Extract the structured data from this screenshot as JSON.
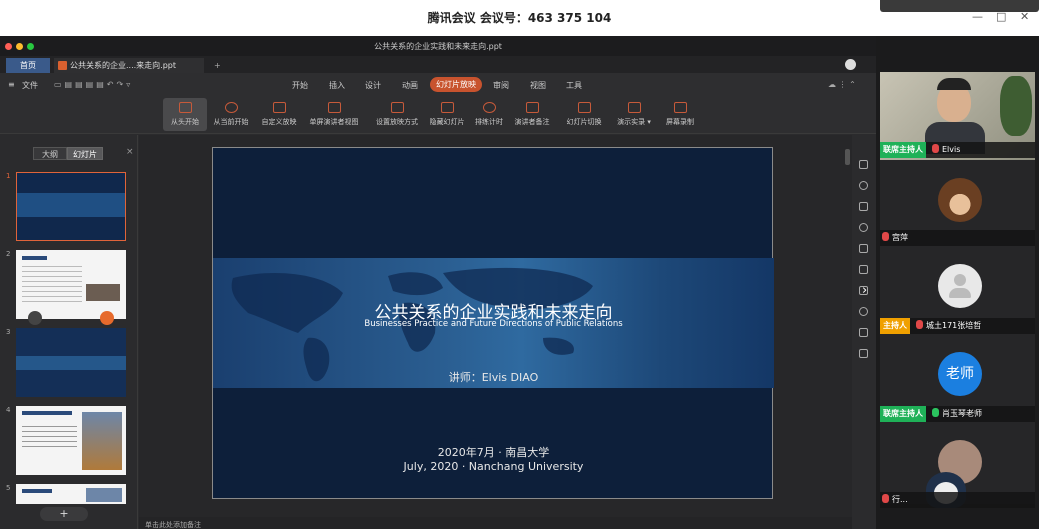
{
  "meeting": {
    "title": "腾讯会议 会议号：463 375 104",
    "window_controls": [
      "—",
      "□",
      "✕"
    ]
  },
  "app": {
    "window_title": "公共关系的企业实践和未来走向.ppt",
    "tabs": [
      {
        "label": "首页"
      },
      {
        "label": "公共关系的企业....来走向.ppt"
      }
    ],
    "new_tab": "+",
    "file_menu": "文件",
    "menu": [
      "开始",
      "插入",
      "设计",
      "动画",
      "幻灯片放映",
      "审阅",
      "视图",
      "工具"
    ],
    "active_menu": "幻灯片放映",
    "ribbon": [
      "从头开始",
      "从当前开始",
      "自定义放映",
      "单屏演讲者视图",
      "设置放映方式",
      "隐藏幻灯片",
      "排练计时",
      "演讲者备注",
      "幻灯片切换",
      "演示实录",
      "屏幕录制"
    ],
    "panel_tabs": [
      "大纲",
      "幻灯片"
    ],
    "panel_close": "×",
    "add_slide": "+",
    "notes_placeholder": "单击此处添加备注",
    "accent": "#c8532e"
  },
  "slides": [
    {
      "num": "1"
    },
    {
      "num": "2"
    },
    {
      "num": "3"
    },
    {
      "num": "4"
    },
    {
      "num": "5"
    }
  ],
  "slide": {
    "title_cn": "公共关系的企业实践和未来走向",
    "title_en": "Businesses Practice and Future Directions of Public Relations",
    "lecturer": "讲师：Elvis DIAO",
    "date_cn": "2020年7月 · 南昌大学",
    "date_en": "July, 2020 · Nanchang University"
  },
  "participants": [
    {
      "role": "联席主持人",
      "name": "Elvis",
      "mic": "muted"
    },
    {
      "role": "",
      "name": "宫萍",
      "mic": "muted"
    },
    {
      "role": "主持人",
      "name": "城土171张培哲",
      "mic": "muted"
    },
    {
      "role": "联席主持人",
      "name": "肖玉琴老师",
      "mic": "active",
      "avatar_text": "老师"
    },
    {
      "role": "",
      "name": "行...",
      "mic": "muted"
    }
  ]
}
